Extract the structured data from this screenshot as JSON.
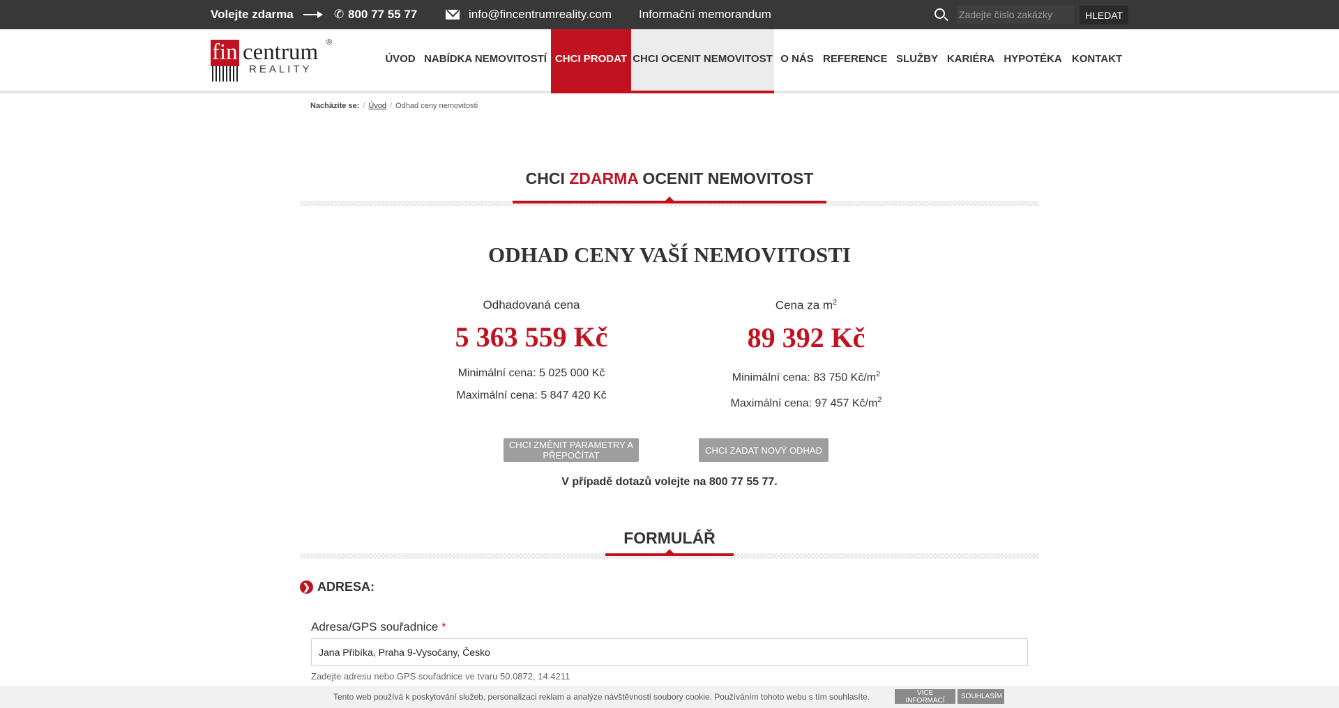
{
  "topbar": {
    "call_label": "Volejte zdarma",
    "phone": "800 77 55 77",
    "email": "info@fincentrumreality.com",
    "memo_link": "Informační memorandum",
    "search_placeholder": "Zadejte číslo zakázky",
    "search_button": "HLEDAT"
  },
  "logo": {
    "fin": "fin",
    "centrum": "centrum",
    "reg": "®",
    "reality": "REALITY"
  },
  "nav": {
    "items": [
      {
        "label": "ÚVOD"
      },
      {
        "label": "NABÍDKA NEMOVITOSTÍ"
      },
      {
        "label": "CHCI PRODAT"
      },
      {
        "label": "CHCI OCENIT NEMOVITOST"
      },
      {
        "label": "O NÁS"
      },
      {
        "label": "REFERENCE"
      },
      {
        "label": "SLUŽBY"
      },
      {
        "label": "KARIÉRA"
      },
      {
        "label": "HYPOTÉKA"
      },
      {
        "label": "KONTAKT"
      }
    ]
  },
  "breadcrumb": {
    "label": "Nacházíte se:",
    "home": "Úvod",
    "current": "Odhad ceny nemovitosti"
  },
  "main_heading": {
    "part1": "CHCI ",
    "part_red": "ZDARMA",
    "part2": " OCENIT NEMOVITOST"
  },
  "estimate": {
    "title": "ODHAD CENY VAŠÍ NEMOVITOSTI",
    "left": {
      "label": "Odhadovaná cena",
      "value": "5 363 559 Kč",
      "min": "Minimální cena: 5 025 000 Kč",
      "max": "Maximální cena: 5 847 420 Kč"
    },
    "right": {
      "label": "Cena za m",
      "value": "89 392 Kč",
      "min": "Minimální cena: 83 750 Kč/m",
      "max": "Maximální cena: 97 457 Kč/m",
      "sup": "2"
    },
    "btn_change": "CHCI ZMĚNIT PARAMETRY A PŘEPOČÍTAT",
    "btn_new": "CHCI ZADAT NOVÝ ODHAD",
    "contact": "V případě dotazů volejte na 800 77 55 77."
  },
  "form": {
    "heading": "FORMULÁŘ",
    "address_section": "ADRESA:",
    "address_icon": "chevron-right-icon",
    "field_label": "Adresa/GPS souřadnice",
    "required_mark": "*",
    "field_value": "Jana Přibíka, Praha 9-Vysočany, Česko",
    "field_hint": "Zadejte adresu nebo GPS souřadnice ve tvaru 50.0872, 14.4211"
  },
  "cookie": {
    "text": "Tento web používá k poskytování služeb, personalizaci reklam a analýze návštěvnosti soubory cookie. Používáním tohoto webu s tím souhlasíte.",
    "more": "VÍCE INFORMACÍ",
    "ok": "SOUHLASÍM"
  },
  "colors": {
    "accent": "#c1121f",
    "topbar": "#383838"
  }
}
